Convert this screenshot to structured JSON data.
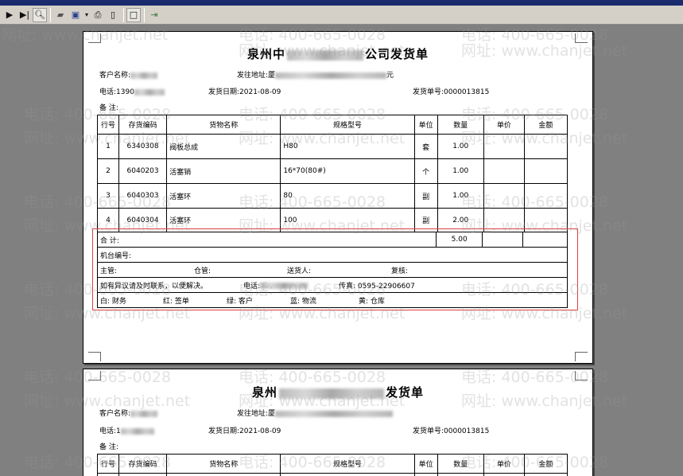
{
  "toolbar": {
    "icons": [
      "play-icon",
      "skip-end-icon",
      "search-icon",
      "folder-icon",
      "save-icon",
      "dropdown-icon",
      "print-icon",
      "page-icon",
      "stop-icon",
      "exit-icon"
    ]
  },
  "doc": {
    "title_left": "泉州中",
    "title_right": "公司发货单",
    "customer_label": "客户名称:",
    "address_label": "发往地址:厦",
    "address_tail": "元",
    "phone_label": "电话:1390",
    "ship_date": "发货日期:2021-08-09",
    "ship_no": "发货单号:0000013815",
    "note_label": "备  注:",
    "headers": [
      "行号",
      "存货编码",
      "货物名称",
      "规格型号",
      "单位",
      "数量",
      "单价",
      "金额"
    ],
    "rows": [
      [
        "1",
        "6340308",
        "阀板总成",
        "H80",
        "套",
        "1.00",
        "",
        ""
      ],
      [
        "2",
        "6040203",
        "活塞销",
        "16*70(80#)",
        "个",
        "1.00",
        "",
        ""
      ],
      [
        "3",
        "6040303",
        "活塞环",
        "80",
        "副",
        "1.00",
        "",
        ""
      ],
      [
        "4",
        "6040304",
        "活塞环",
        "100",
        "副",
        "2.00",
        "",
        ""
      ]
    ],
    "total_label": "合    计:",
    "total_qty": "5.00",
    "machine_no": "机台编号:",
    "supervisor": "主管:",
    "warehouse": "仓管:",
    "deliverer": "送货人:",
    "reviewer": "复核:",
    "dispute": "如有异议请及时联系，以便解决。",
    "phone2": "电话:",
    "fax": "传真: 0595-22906607",
    "copy_white": "白: 财务",
    "copy_red": "红: 签单",
    "copy_green": "绿: 客户",
    "copy_blue": "蓝: 物流",
    "copy_yellow": "黄: 仓库"
  },
  "doc2": {
    "title_left": "泉州",
    "title_right": "发货单",
    "customer_label": "客户名称:",
    "address_label": "发往地址:厦",
    "phone_label": "电话:1",
    "ship_date": "发货日期:2021-08-09",
    "ship_no": "发货单号:0000013815",
    "note_label": "备  注:"
  },
  "watermark": {
    "phone": "电话: 400-665-0028",
    "site": "网址: www.chanjet.net"
  }
}
